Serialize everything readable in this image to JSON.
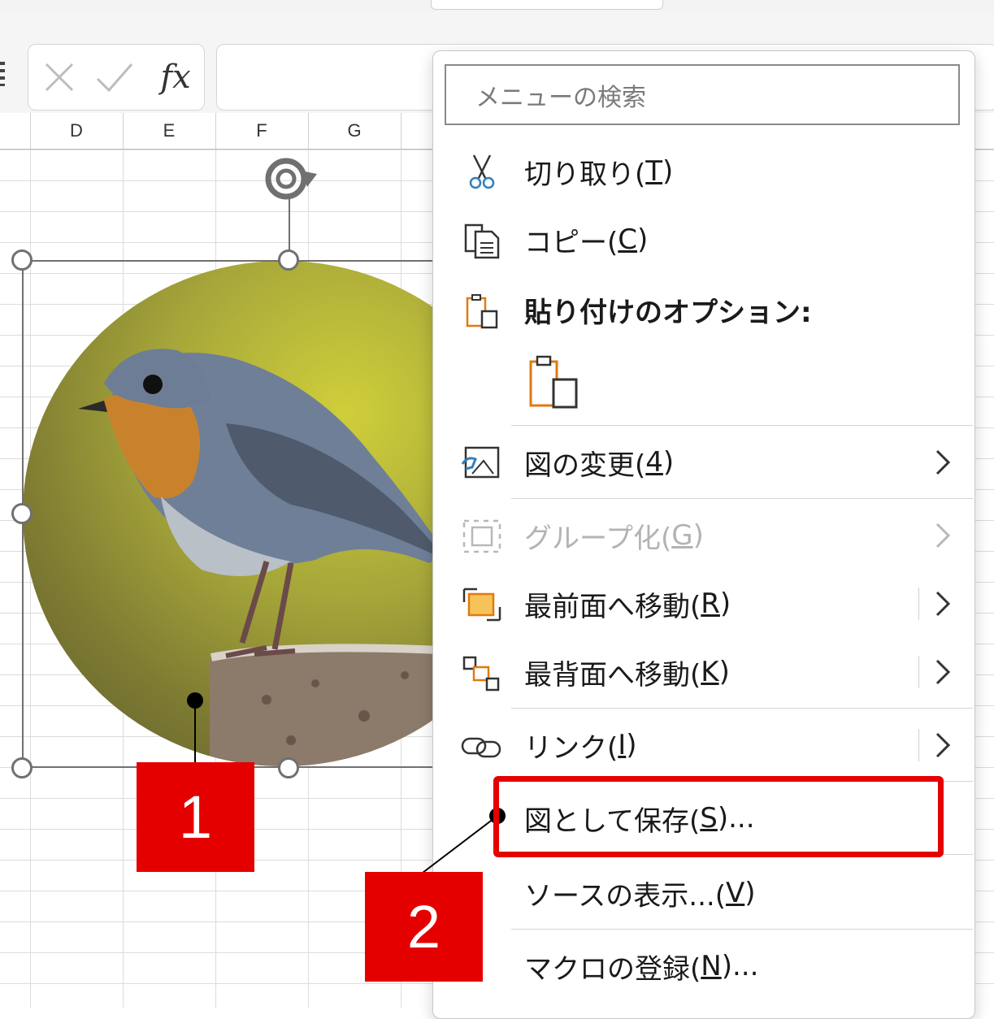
{
  "formula_bar": {
    "fx_label": "fx"
  },
  "columns": [
    "D",
    "E",
    "F",
    "G"
  ],
  "context_menu": {
    "search_placeholder": "メニューの検索",
    "items": [
      {
        "label": "切り取り(",
        "key": "T",
        "suffix": ")",
        "icon": "scissors-icon"
      },
      {
        "label": "コピー(",
        "key": "C",
        "suffix": ")",
        "icon": "copy-icon"
      },
      {
        "label": "貼り付けのオプション:",
        "icon": "paste-icon"
      },
      {
        "label": "図の変更(",
        "key": "4",
        "suffix": ")",
        "icon": "change-picture-icon"
      },
      {
        "label": "グループ化(",
        "key": "G",
        "suffix": ")",
        "icon": "group-icon",
        "disabled": true
      },
      {
        "label": "最前面へ移動(",
        "key": "R",
        "suffix": ")",
        "icon": "bring-to-front-icon"
      },
      {
        "label": "最背面へ移動(",
        "key": "K",
        "suffix": ")",
        "icon": "send-to-back-icon"
      },
      {
        "label": "リンク(",
        "key": "I",
        "suffix": ")",
        "icon": "link-icon"
      },
      {
        "label": "図として保存(",
        "key": "S",
        "suffix": ")..."
      },
      {
        "label": "ソースの表示...(",
        "key": "V",
        "suffix": ")"
      },
      {
        "label": "マクロの登録(",
        "key": "N",
        "suffix": ")..."
      }
    ]
  },
  "callouts": {
    "first": "1",
    "second": "2"
  },
  "colors": {
    "accent_red": "#e50000",
    "paste_orange": "#e07a10",
    "icon_blue": "#2f7fc0"
  }
}
